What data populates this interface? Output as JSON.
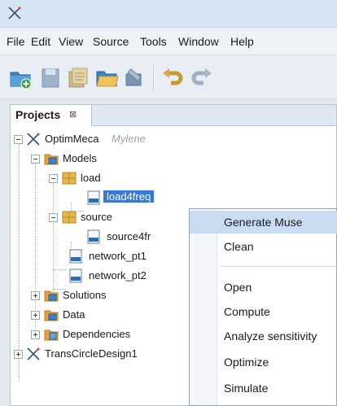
{
  "menubar": {
    "items": [
      "File",
      "Edit",
      "View",
      "Source",
      "Tools",
      "Window",
      "Help"
    ]
  },
  "projects_panel": {
    "tab_label": "Projects",
    "tab_close": "⊠"
  },
  "tree": {
    "root1": {
      "label": "OptimMeca",
      "annotation": "Mylene"
    },
    "models": "Models",
    "load": "load",
    "load4freq": "load4freq",
    "source": "source",
    "source4fr": "source4fr",
    "network_pt1": "network_pt1",
    "network_pt2": "network_pt2",
    "solutions": "Solutions",
    "data": "Data",
    "dependencies": "Dependencies",
    "root2": "TransCircleDesign1"
  },
  "context_menu": {
    "generate_muse": "Generate Muse",
    "clean": "Clean",
    "open": "Open",
    "compute": "Compute",
    "analyze_sensitivity": "Analyze sensitivity",
    "optimize": "Optimize",
    "simulate": "Simulate"
  },
  "colors": {
    "selection": "#3a78d4",
    "menu_highlight": "#c9dcf2",
    "folder_orange": "#e8a13a",
    "package_yellow": "#e6b64a",
    "file_blue": "#2f6bb5"
  },
  "icons": {
    "new_project": "new-project-icon",
    "save": "save-icon",
    "save_all": "save-all-icon",
    "open_project": "open-project-icon",
    "build": "build-icon",
    "undo": "undo-icon",
    "redo": "redo-icon"
  }
}
